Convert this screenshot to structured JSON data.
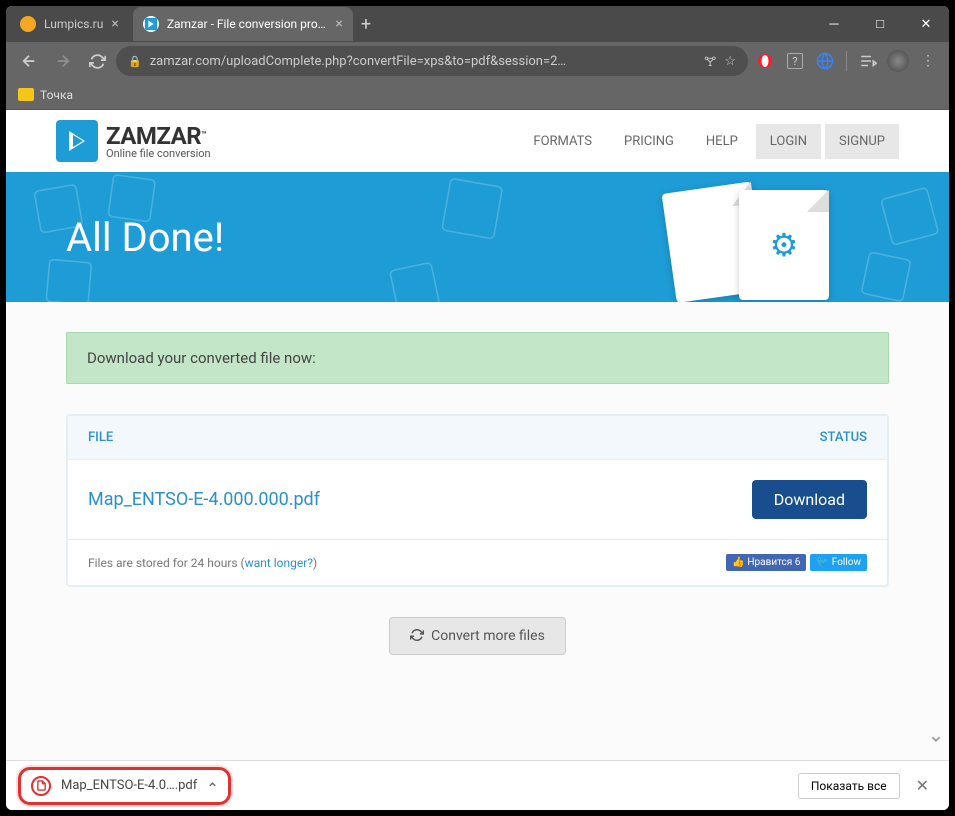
{
  "tabs": [
    {
      "title": "Lumpics.ru"
    },
    {
      "title": "Zamzar - File conversion progres"
    }
  ],
  "url": "zamzar.com/uploadComplete.php?convertFile=xps&to=pdf&session=2…",
  "bookmarks": {
    "item1": "Точка"
  },
  "logo": {
    "brand": "ZAMZAR",
    "tm": "™",
    "sub": "Online file conversion"
  },
  "nav": {
    "formats": "FORMATS",
    "pricing": "PRICING",
    "help": "HELP",
    "login": "LOGIN",
    "signup": "SIGNUP"
  },
  "banner": {
    "title": "All Done!"
  },
  "alert": "Download your converted file now:",
  "table": {
    "file_header": "FILE",
    "status_header": "STATUS",
    "filename": "Map_ENTSO-E-4.000.000.pdf",
    "download": "Download",
    "stored": "Files are stored for 24 hours (",
    "want_longer": "want longer?",
    "stored_close": ")"
  },
  "social": {
    "fb": "Нравится 6",
    "tw": "Follow"
  },
  "convert_more": "Convert more files",
  "downloads": {
    "filename": "Map_ENTSO-E-4.0….pdf",
    "show_all": "Показать все"
  }
}
